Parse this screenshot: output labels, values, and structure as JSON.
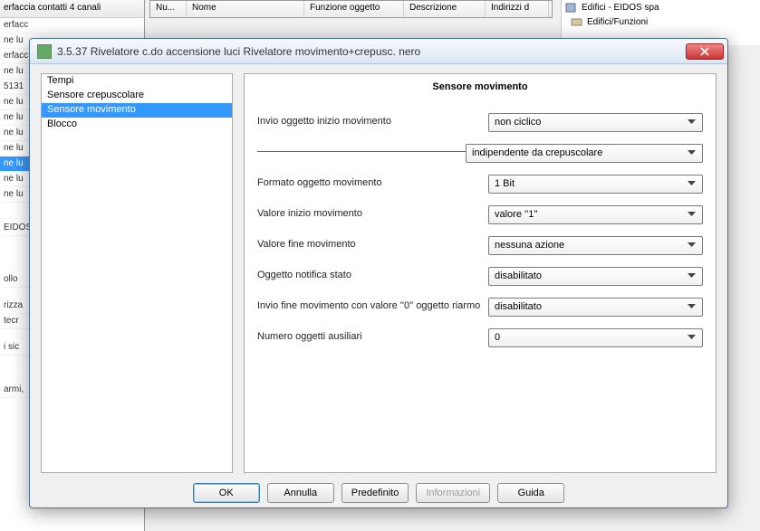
{
  "bg": {
    "left_head": "erfaccia contatti 4 canali",
    "left_rows": [
      "erfacc",
      "ne lu",
      "erfacc",
      "ne lu",
      "5131",
      "ne lu",
      "ne lu",
      "ne lu",
      "ne lu",
      "ne lu",
      "ne lu",
      "ne lu"
    ],
    "left_sel_index": 9,
    "mid_cols": [
      "Nu...",
      "Nome",
      "Funzione oggetto",
      "Descrizione",
      "Indirizzi d"
    ],
    "right_rows": [
      "Edifici - EIDOS spa",
      "Edifici/Funzioni"
    ],
    "eidos": "EIDOS",
    "ollo": "ollo",
    "rizza": "rizza",
    "tecr": "tecr",
    "sic": "i sic",
    "armi": "armi,"
  },
  "dialog": {
    "title": "3.5.37 Rivelatore c.do accensione luci Rivelatore movimento+crepusc. nero"
  },
  "sidebar": {
    "items": [
      {
        "label": "Tempi"
      },
      {
        "label": "Sensore crepuscolare"
      },
      {
        "label": "Sensore movimento"
      },
      {
        "label": "Blocco"
      }
    ],
    "selected": 2
  },
  "panel": {
    "title": "Sensore movimento",
    "rows": [
      {
        "label": "Invio oggetto inizio movimento",
        "value": "non ciclico"
      },
      {
        "label": "__divider__",
        "value": "indipendente da crepuscolare"
      },
      {
        "label": "Formato oggetto movimento",
        "value": "1 Bit"
      },
      {
        "label": "Valore inizio movimento",
        "value": "valore ''1''"
      },
      {
        "label": "Valore fine movimento",
        "value": "nessuna azione"
      },
      {
        "label": "Oggetto notifica stato",
        "value": "disabilitato"
      },
      {
        "label": "Invio fine movimento con valore ''0'' oggetto riarmo",
        "value": "disabilitato"
      },
      {
        "label": "Numero oggetti ausiliari",
        "value": "0"
      }
    ]
  },
  "buttons": {
    "ok": "OK",
    "cancel": "Annulla",
    "default": "Predefinito",
    "info": "Informazioni",
    "help": "Guida"
  }
}
